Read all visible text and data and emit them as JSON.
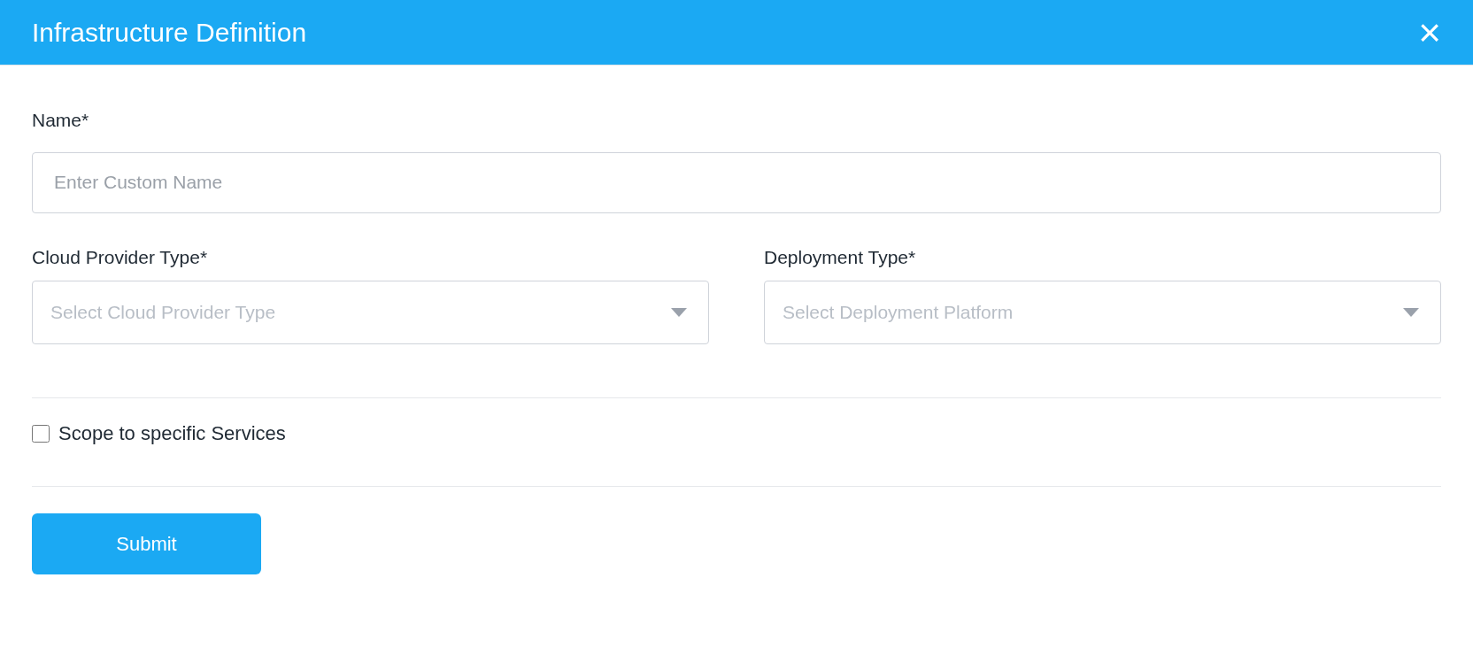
{
  "dialog": {
    "title": "Infrastructure Definition",
    "close": "×"
  },
  "name_field": {
    "label": "Name*",
    "placeholder": "Enter Custom Name"
  },
  "selects": [
    {
      "label": "Cloud Provider Type*",
      "placeholder": "Select Cloud Provider Type"
    },
    {
      "label": "Deployment Type*",
      "placeholder": "Select Deployment Platform"
    }
  ],
  "scope_checkbox": {
    "label": "Scope to specific Services",
    "checked": false
  },
  "submit": "Submit"
}
